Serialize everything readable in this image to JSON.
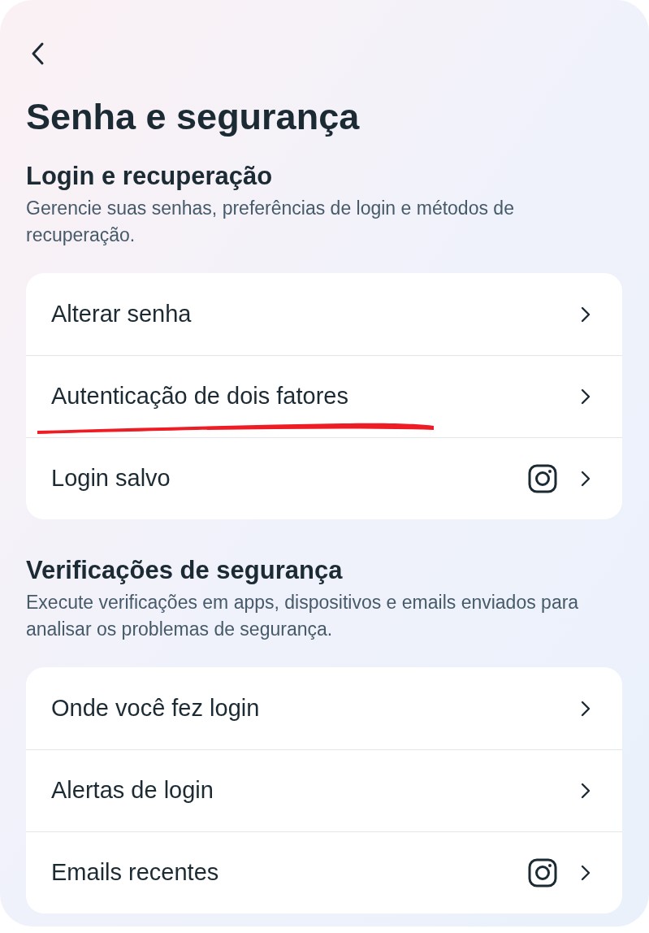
{
  "title": "Senha e segurança",
  "sections": [
    {
      "heading": "Login e recuperação",
      "description": "Gerencie suas senhas, preferências de login e métodos de recuperação.",
      "items": [
        {
          "label": "Alterar senha",
          "kind": "plain"
        },
        {
          "label": "Autenticação de dois fatores",
          "kind": "plain"
        },
        {
          "label": "Login salvo",
          "kind": "app"
        }
      ]
    },
    {
      "heading": "Verificações de segurança",
      "description": "Execute verificações em apps, dispositivos e emails enviados para analisar os problemas de segurança.",
      "items": [
        {
          "label": "Onde você fez login",
          "kind": "plain"
        },
        {
          "label": "Alertas de login",
          "kind": "plain"
        },
        {
          "label": "Emails recentes",
          "kind": "app"
        }
      ]
    }
  ]
}
